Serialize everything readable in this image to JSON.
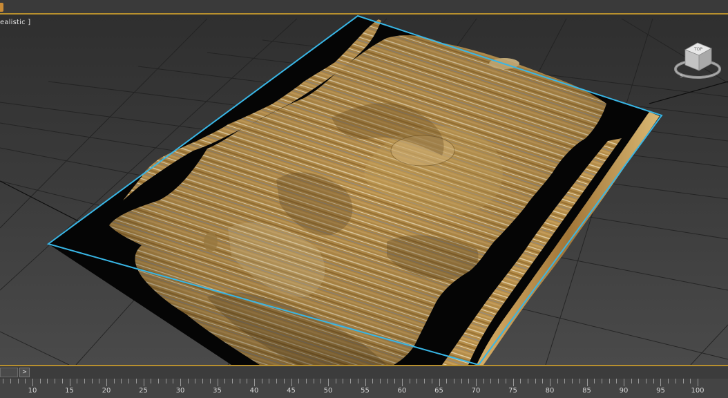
{
  "viewport": {
    "label": "ealistic ]",
    "render_mode": "Realistic"
  },
  "viewcube": {
    "face_label": "TOP"
  },
  "timeline": {
    "next_button_label": ">",
    "ruler_labels": [
      "10",
      "15",
      "20",
      "25",
      "30",
      "35",
      "40",
      "45",
      "50",
      "55",
      "60",
      "65",
      "70",
      "75",
      "80",
      "85",
      "90",
      "95",
      "100"
    ]
  },
  "colors": {
    "accent": "#b8902e",
    "selection_outline": "#38b6e6",
    "terrain_base": "#b8914a",
    "viewport_bg": "#3a3a3a"
  }
}
